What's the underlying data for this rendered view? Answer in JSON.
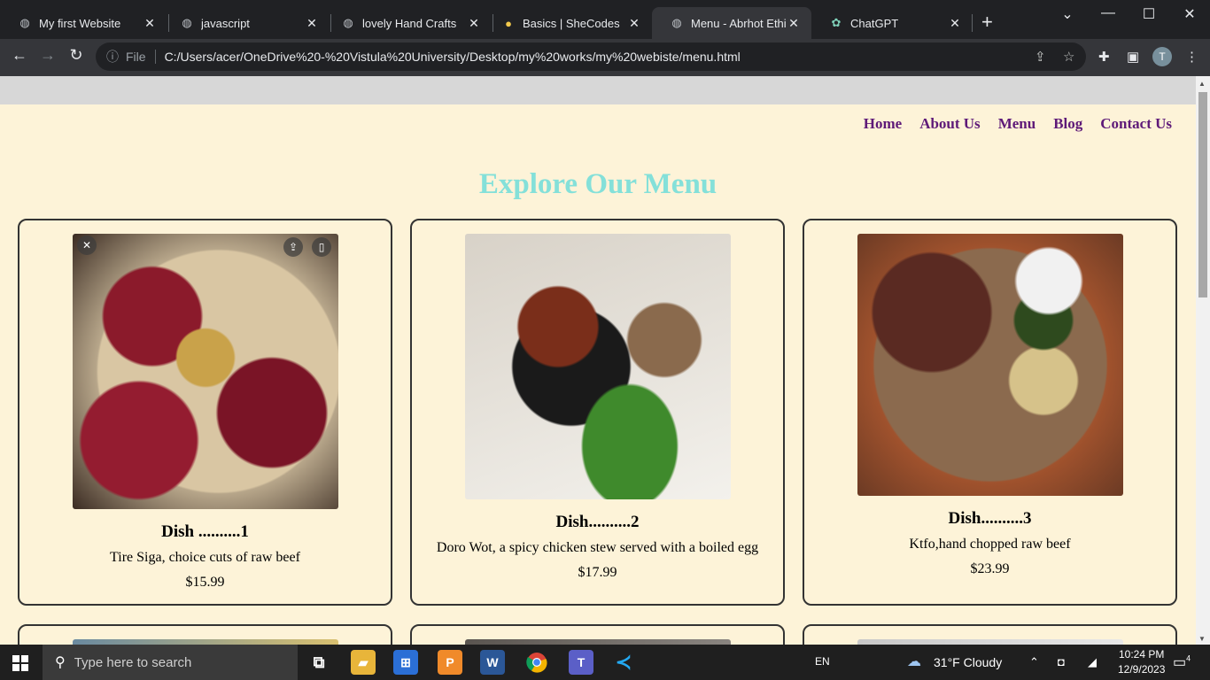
{
  "browser": {
    "tabs": [
      {
        "title": "My first Website",
        "icon": "globe-icon"
      },
      {
        "title": "javascript",
        "icon": "globe-icon"
      },
      {
        "title": "lovely Hand Crafts",
        "icon": "globe-icon"
      },
      {
        "title": "Basics | SheCodes",
        "icon": "shecodes-icon"
      },
      {
        "title": "Menu - Abrhot Ethiop",
        "icon": "globe-icon"
      },
      {
        "title": "ChatGPT",
        "icon": "chatgpt-icon"
      }
    ],
    "url_scheme": "File",
    "url": "C:/Users/acer/OneDrive%20-%20Vistula%20University/Desktop/my%20works/my%20webiste/menu.html",
    "profile_initial": "T"
  },
  "page": {
    "nav": [
      "Home",
      "About Us",
      "Menu",
      "Blog",
      "Contact Us"
    ],
    "heading": "Explore Our Menu",
    "dishes": [
      {
        "name": "Dish ..........1",
        "description": "Tire Siga, choice cuts of raw beef",
        "price": "$15.99"
      },
      {
        "name": "Dish..........2",
        "description": "Doro Wot, a spicy chicken stew served with a boiled egg",
        "price": "$17.99"
      },
      {
        "name": "Dish..........3",
        "description": "Ktfo,hand chopped raw beef",
        "price": "$23.99"
      }
    ]
  },
  "taskbar": {
    "search_placeholder": "Type here to search",
    "language": "EN",
    "weather": "31°F  Cloudy",
    "time": "10:24 PM",
    "date": "12/9/2023",
    "notifications": "4"
  },
  "colors": {
    "page_bg": "#fdf3d8",
    "nav_link": "#5e1a78",
    "heading": "#84e0d9"
  }
}
